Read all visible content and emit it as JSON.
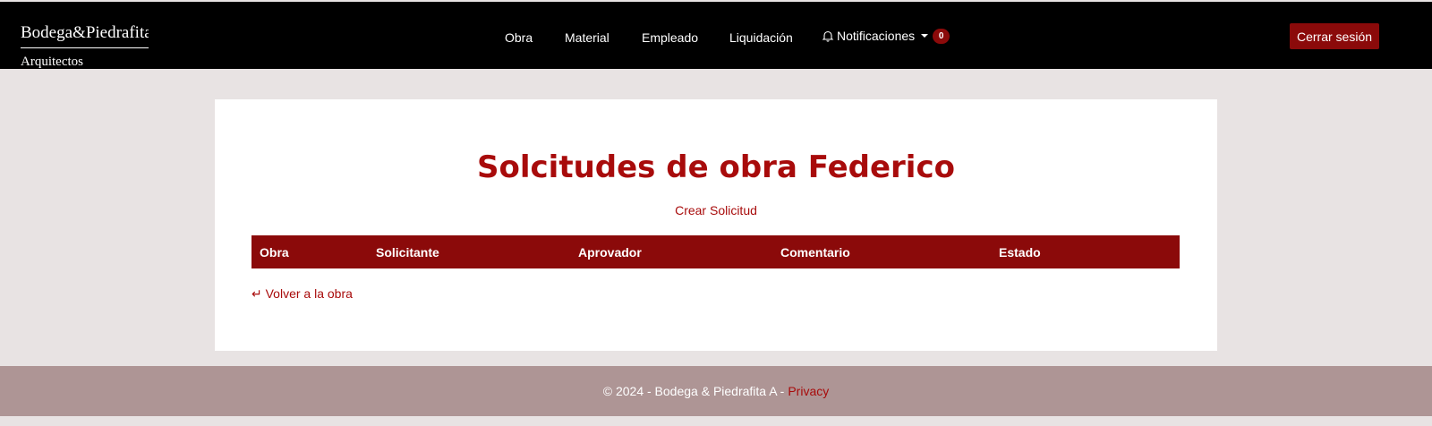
{
  "brand": {
    "line1": "Bodega&Piedrafita",
    "line2": "Arquitectos"
  },
  "nav": {
    "items": [
      "Obra",
      "Material",
      "Empleado",
      "Liquidación"
    ],
    "notifications_label": "Notificaciones",
    "notifications_count": "0"
  },
  "logout_label": "Cerrar sesión",
  "main": {
    "title": "Solcitudes de obra Federico",
    "create_link": "Crear Solicitud",
    "table": {
      "headers": [
        "Obra",
        "Solicitante",
        "Aprovador",
        "Comentario",
        "Estado"
      ],
      "rows": []
    },
    "back_link": "↵ Volver a la obra"
  },
  "footer": {
    "text": "© 2024 - Bodega & Piedrafita A - ",
    "privacy_link": "Privacy"
  },
  "colors": {
    "accent": "#8b0a0a",
    "title": "#a80b0b",
    "footer_bg": "#ae9595",
    "page_bg": "#e8e3e3"
  },
  "icons": {
    "notifications": "bell-icon"
  }
}
